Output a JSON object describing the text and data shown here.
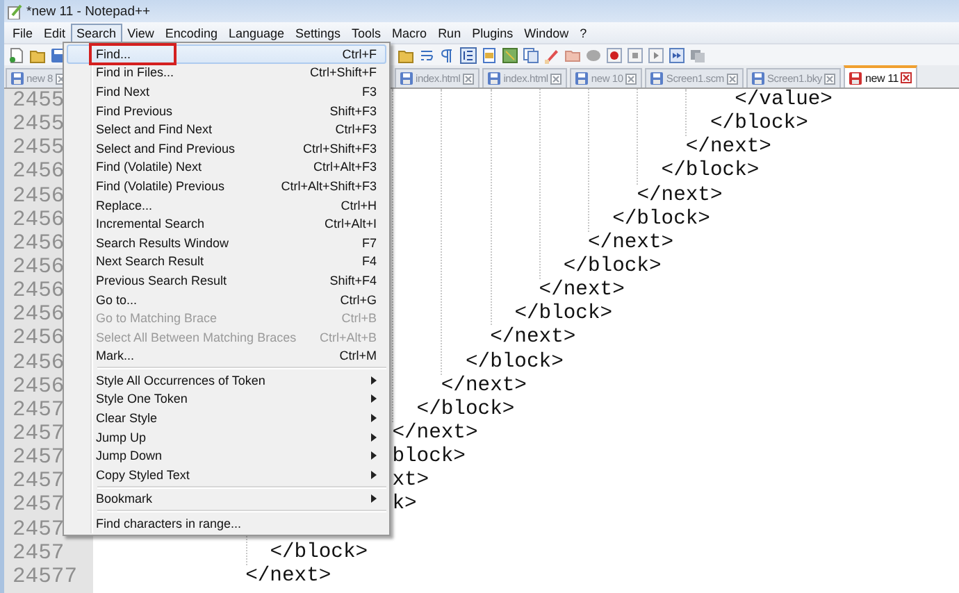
{
  "window": {
    "title": "*new 11 - Notepad++"
  },
  "menu_bar": [
    {
      "label": "File",
      "selected": false
    },
    {
      "label": "Edit",
      "selected": false
    },
    {
      "label": "Search",
      "selected": true
    },
    {
      "label": "View",
      "selected": false
    },
    {
      "label": "Encoding",
      "selected": false
    },
    {
      "label": "Language",
      "selected": false
    },
    {
      "label": "Settings",
      "selected": false
    },
    {
      "label": "Tools",
      "selected": false
    },
    {
      "label": "Macro",
      "selected": false
    },
    {
      "label": "Run",
      "selected": false
    },
    {
      "label": "Plugins",
      "selected": false
    },
    {
      "label": "Window",
      "selected": false
    },
    {
      "label": "?",
      "selected": false
    }
  ],
  "tabs": [
    {
      "label": "new 8",
      "selected": false,
      "unsaved": false
    },
    {
      "label": "index.html",
      "selected": false,
      "unsaved": false
    },
    {
      "label": "index.html",
      "selected": false,
      "unsaved": false
    },
    {
      "label": "new 10",
      "selected": false,
      "unsaved": false
    },
    {
      "label": "Screen1.scm",
      "selected": false,
      "unsaved": false
    },
    {
      "label": "Screen1.bky",
      "selected": false,
      "unsaved": false
    },
    {
      "label": "new 11",
      "selected": true,
      "unsaved": true
    }
  ],
  "editor": {
    "lines": [
      {
        "number": "2455",
        "code": "</value>"
      },
      {
        "number": "2455",
        "code": "</block>"
      },
      {
        "number": "2455",
        "code": "</next>"
      },
      {
        "number": "2456",
        "code": "</block>"
      },
      {
        "number": "2456",
        "code": "</next>"
      },
      {
        "number": "2456",
        "code": "</block>"
      },
      {
        "number": "2456",
        "code": "</next>"
      },
      {
        "number": "2456",
        "code": "</block>"
      },
      {
        "number": "2456",
        "code": "</next>"
      },
      {
        "number": "2456",
        "code": "</block>"
      },
      {
        "number": "2456",
        "code": "</next>"
      },
      {
        "number": "2456",
        "code": "</block>"
      },
      {
        "number": "2456",
        "code": "</next>"
      },
      {
        "number": "2457",
        "code": "</block>"
      },
      {
        "number": "2457",
        "code": "</next>"
      },
      {
        "number": "2457",
        "code": "block>"
      },
      {
        "number": "2457",
        "code": "xt>"
      },
      {
        "number": "2457",
        "code": "k>"
      },
      {
        "number": "2457"
      },
      {
        "number": "2457",
        "code": "</block>"
      },
      {
        "number": "24577",
        "code": "</next>"
      }
    ]
  },
  "search_menu": {
    "items": [
      {
        "kind": "item",
        "label": "Find...",
        "shortcut": "Ctrl+F",
        "selected": true,
        "annotated": true,
        "disabled": false
      },
      {
        "kind": "item",
        "label": "Find in Files...",
        "shortcut": "Ctrl+Shift+F",
        "selected": false,
        "disabled": false
      },
      {
        "kind": "item",
        "label": "Find Next",
        "shortcut": "F3",
        "selected": false,
        "disabled": false
      },
      {
        "kind": "item",
        "label": "Find Previous",
        "shortcut": "Shift+F3",
        "selected": false,
        "disabled": false
      },
      {
        "kind": "item",
        "label": "Select and Find Next",
        "shortcut": "Ctrl+F3",
        "selected": false,
        "disabled": false
      },
      {
        "kind": "item",
        "label": "Select and Find Previous",
        "shortcut": "Ctrl+Shift+F3",
        "selected": false,
        "disabled": false
      },
      {
        "kind": "item",
        "label": "Find (Volatile) Next",
        "shortcut": "Ctrl+Alt+F3",
        "selected": false,
        "disabled": false
      },
      {
        "kind": "item",
        "label": "Find (Volatile) Previous",
        "shortcut": "Ctrl+Alt+Shift+F3",
        "selected": false,
        "disabled": false
      },
      {
        "kind": "item",
        "label": "Replace...",
        "shortcut": "Ctrl+H",
        "selected": false,
        "disabled": false
      },
      {
        "kind": "item",
        "label": "Incremental Search",
        "shortcut": "Ctrl+Alt+I",
        "selected": false,
        "disabled": false
      },
      {
        "kind": "item",
        "label": "Search Results Window",
        "shortcut": "F7",
        "selected": false,
        "disabled": false
      },
      {
        "kind": "item",
        "label": "Next Search Result",
        "shortcut": "F4",
        "selected": false,
        "disabled": false
      },
      {
        "kind": "item",
        "label": "Previous Search Result",
        "shortcut": "Shift+F4",
        "selected": false,
        "disabled": false
      },
      {
        "kind": "item",
        "label": "Go to...",
        "shortcut": "Ctrl+G",
        "selected": false,
        "disabled": false
      },
      {
        "kind": "item",
        "label": "Go to Matching Brace",
        "shortcut": "Ctrl+B",
        "selected": false,
        "disabled": true
      },
      {
        "kind": "item",
        "label": "Select All Between Matching Braces",
        "shortcut": "Ctrl+Alt+B",
        "selected": false,
        "disabled": true
      },
      {
        "kind": "item",
        "label": "Mark...",
        "shortcut": "Ctrl+M",
        "selected": false,
        "disabled": false
      },
      {
        "kind": "separator"
      },
      {
        "kind": "submenu",
        "label": "Style All Occurrences of Token",
        "selected": false,
        "disabled": false
      },
      {
        "kind": "submenu",
        "label": "Style One Token",
        "selected": false,
        "disabled": false
      },
      {
        "kind": "submenu",
        "label": "Clear Style",
        "selected": false,
        "disabled": false
      },
      {
        "kind": "submenu",
        "label": "Jump Up",
        "selected": false,
        "disabled": false
      },
      {
        "kind": "submenu",
        "label": "Jump Down",
        "selected": false,
        "disabled": false
      },
      {
        "kind": "submenu",
        "label": "Copy Styled Text",
        "selected": false,
        "disabled": false
      },
      {
        "kind": "separator"
      },
      {
        "kind": "submenu",
        "label": "Bookmark",
        "selected": false,
        "disabled": false
      },
      {
        "kind": "separator"
      },
      {
        "kind": "item",
        "label": "Find characters in range...",
        "selected": false,
        "disabled": false
      }
    ]
  }
}
